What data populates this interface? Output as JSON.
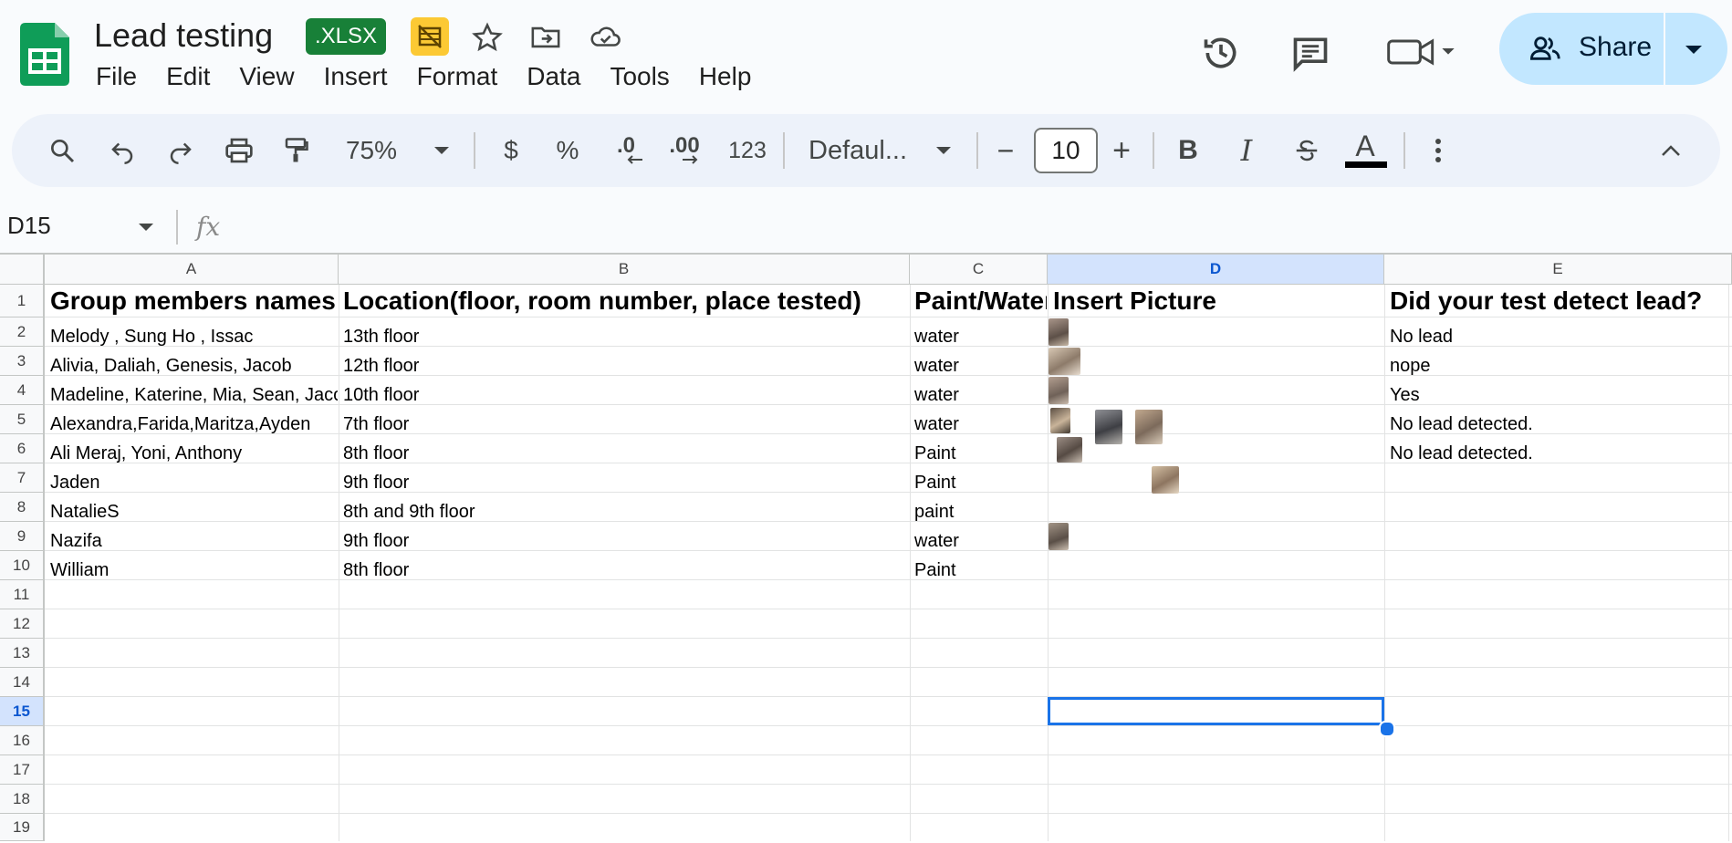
{
  "app": {
    "title": "Lead testing",
    "file_badge": ".XLSX",
    "menu": [
      "File",
      "Edit",
      "View",
      "Insert",
      "Format",
      "Data",
      "Tools",
      "Help"
    ],
    "share_label": "Share"
  },
  "toolbar": {
    "zoom": "75%",
    "currency": "$",
    "percent": "%",
    "dec_decrease": ".0",
    "dec_increase": ".00",
    "number_format": "123",
    "font": "Defaul...",
    "font_size": "10",
    "minus": "−",
    "plus": "+",
    "bold": "B",
    "italic": "I",
    "text_color_letter": "A",
    "text_color": "#000000"
  },
  "formula_bar": {
    "name_box": "D15",
    "fx": "fx"
  },
  "grid": {
    "columns": [
      "A",
      "B",
      "C",
      "D",
      "E"
    ],
    "rows": [
      "1",
      "2",
      "3",
      "4",
      "5",
      "6",
      "7",
      "8",
      "9",
      "10",
      "11",
      "12",
      "13",
      "14",
      "15",
      "16",
      "17",
      "18",
      "19"
    ],
    "selected_column": "D",
    "selected_row": "15",
    "header_row": [
      "Group members names",
      "Location(floor, room number, place tested)",
      "Paint/Water",
      "Insert Picture",
      "Did your test detect lead?"
    ],
    "data_rows": [
      [
        "Melody , Sung Ho , Issac",
        "13th floor",
        "water",
        "",
        "No lead"
      ],
      [
        "Alivia, Daliah, Genesis, Jacob",
        "12th floor",
        "water",
        "",
        "nope"
      ],
      [
        "Madeline, Katerine, Mia, Sean, Jacob",
        "10th floor",
        "water",
        "",
        "Yes"
      ],
      [
        "Alexandra,Farida,Maritza,Ayden",
        "7th floor",
        "water",
        "",
        "No lead detected."
      ],
      [
        "Ali Meraj, Yoni, Anthony",
        "8th floor",
        "Paint",
        "",
        "No lead detected."
      ],
      [
        "Jaden",
        "9th floor",
        "Paint",
        "",
        ""
      ],
      [
        "NatalieS",
        "8th and 9th floor",
        "paint",
        "",
        ""
      ],
      [
        "Nazifa",
        "9th floor",
        "water",
        "",
        ""
      ],
      [
        "William",
        "8th floor",
        "Paint",
        "",
        ""
      ]
    ]
  },
  "colors": {
    "accent": "#1a73e8",
    "share_bg": "#c2e7ff",
    "xlsx_badge": "#188038",
    "sheets_green": "#0f9d58"
  }
}
